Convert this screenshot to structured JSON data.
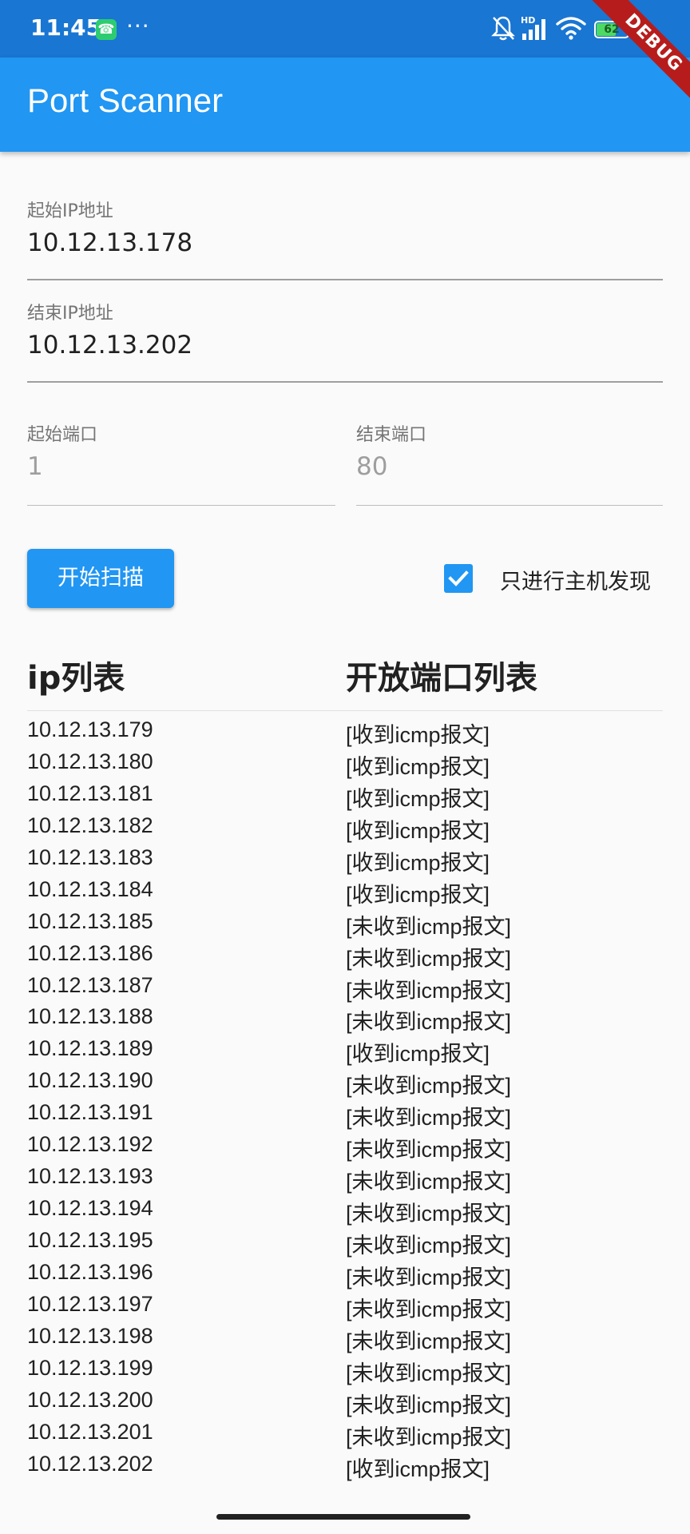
{
  "status_bar": {
    "time": "11:45",
    "overflow": "···",
    "network_badge": "HD",
    "battery_level": 62,
    "battery_text": "62",
    "icons": [
      "phone-call-icon",
      "bell-muted-icon",
      "signal-icon",
      "wifi-icon",
      "battery-icon"
    ]
  },
  "debug_banner": "DEBUG",
  "app_bar": {
    "title": "Port Scanner"
  },
  "form": {
    "start_ip": {
      "label": "起始IP地址",
      "value": "10.12.13.178"
    },
    "end_ip": {
      "label": "结束IP地址",
      "value": "10.12.13.202"
    },
    "start_port": {
      "label": "起始端口",
      "placeholder": "1"
    },
    "end_port": {
      "label": "结束端口",
      "placeholder": "80"
    }
  },
  "scan_button": {
    "label": "开始扫描"
  },
  "host_discovery": {
    "label": "只进行主机发现",
    "checked": true
  },
  "results": {
    "columns": [
      "ip列表",
      "开放端口列表"
    ],
    "rows": [
      {
        "ip": "10.12.13.179",
        "ports": "[收到icmp报文]"
      },
      {
        "ip": "10.12.13.180",
        "ports": "[收到icmp报文]"
      },
      {
        "ip": "10.12.13.181",
        "ports": "[收到icmp报文]"
      },
      {
        "ip": "10.12.13.182",
        "ports": "[收到icmp报文]"
      },
      {
        "ip": "10.12.13.183",
        "ports": "[收到icmp报文]"
      },
      {
        "ip": "10.12.13.184",
        "ports": "[收到icmp报文]"
      },
      {
        "ip": "10.12.13.185",
        "ports": "[未收到icmp报文]"
      },
      {
        "ip": "10.12.13.186",
        "ports": "[未收到icmp报文]"
      },
      {
        "ip": "10.12.13.187",
        "ports": "[未收到icmp报文]"
      },
      {
        "ip": "10.12.13.188",
        "ports": "[未收到icmp报文]"
      },
      {
        "ip": "10.12.13.189",
        "ports": "[收到icmp报文]"
      },
      {
        "ip": "10.12.13.190",
        "ports": "[未收到icmp报文]"
      },
      {
        "ip": "10.12.13.191",
        "ports": "[未收到icmp报文]"
      },
      {
        "ip": "10.12.13.192",
        "ports": "[未收到icmp报文]"
      },
      {
        "ip": "10.12.13.193",
        "ports": "[未收到icmp报文]"
      },
      {
        "ip": "10.12.13.194",
        "ports": "[未收到icmp报文]"
      },
      {
        "ip": "10.12.13.195",
        "ports": "[未收到icmp报文]"
      },
      {
        "ip": "10.12.13.196",
        "ports": "[未收到icmp报文]"
      },
      {
        "ip": "10.12.13.197",
        "ports": "[未收到icmp报文]"
      },
      {
        "ip": "10.12.13.198",
        "ports": "[未收到icmp报文]"
      },
      {
        "ip": "10.12.13.199",
        "ports": "[未收到icmp报文]"
      },
      {
        "ip": "10.12.13.200",
        "ports": "[未收到icmp报文]"
      },
      {
        "ip": "10.12.13.201",
        "ports": "[未收到icmp报文]"
      },
      {
        "ip": "10.12.13.202",
        "ports": "[收到icmp报文]"
      }
    ]
  },
  "colors": {
    "status_bar": "#1976d2",
    "app_bar": "#2196f3",
    "accent": "#2196f3",
    "background": "#fafafa",
    "debug": "#b71c1c"
  }
}
